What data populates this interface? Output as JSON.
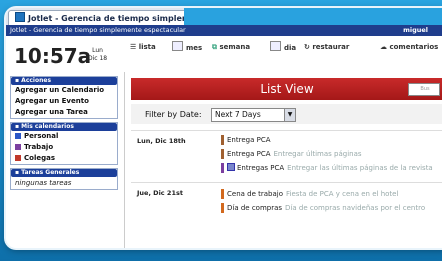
{
  "window": {
    "tab_title": "Jotlet - Gerencia de tiempo simpleme...",
    "title": "Jotlet - Gerencia de tiempo simplemente espectacular",
    "user": "miguel"
  },
  "clock": {
    "time": "10:57a",
    "weekday": "Lun",
    "day": "Dic 18"
  },
  "toolbar": {
    "items": [
      {
        "label": "lista",
        "icon": "list-icon"
      },
      {
        "label": "mes",
        "icon": "month-icon"
      },
      {
        "label": "semana",
        "icon": "week-icon"
      },
      {
        "label": "dia",
        "icon": "day-icon"
      },
      {
        "label": "restaurar",
        "icon": "refresh-icon"
      },
      {
        "label": "comentarios",
        "icon": "comment-icon"
      }
    ]
  },
  "sidebar": {
    "actions": {
      "header": "Acciones",
      "links": [
        "Agregar un Calendario",
        "Agregar un Evento",
        "Agregar una Tarea"
      ]
    },
    "calendars": {
      "header": "Mis calendarios",
      "items": [
        {
          "name": "Personal",
          "color": "#2a56c6"
        },
        {
          "name": "Trabajo",
          "color": "#7b3fa0"
        },
        {
          "name": "Colegas",
          "color": "#c0392b"
        }
      ]
    },
    "tasks": {
      "header": "Tareas Generales",
      "empty": "ningunas tareas"
    }
  },
  "main": {
    "title": "List View",
    "search_placeholder": "Bus",
    "filter_label": "Filter by Date:",
    "filter_value": "Next 7 Days",
    "days": [
      {
        "label": "Lun, Dic 18th",
        "events": [
          {
            "title": "Entrega PCA",
            "desc": ""
          },
          {
            "title": "Entrega PCA",
            "desc": "Entregar últimas páginas"
          },
          {
            "title": "Entregas PCA",
            "desc": "Entregar las últimas páginas de la revista"
          }
        ]
      },
      {
        "label": "Jue, Dic 21st",
        "events": [
          {
            "title": "Cena de trabajo",
            "desc": "Fiesta de PCA y cena en el hotel"
          },
          {
            "title": "Día de compras",
            "desc": "Día de compras navideñas por el centro"
          }
        ]
      }
    ]
  }
}
